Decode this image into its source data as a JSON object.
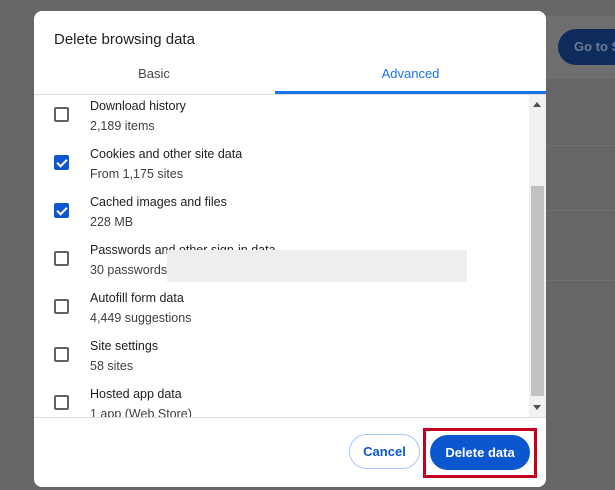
{
  "background": {
    "button_label": "Go to S"
  },
  "dialog": {
    "title": "Delete browsing data",
    "tabs": [
      {
        "label": "Basic",
        "selected": false
      },
      {
        "label": "Advanced",
        "selected": true
      }
    ],
    "items": [
      {
        "title": "Download history",
        "subtitle": "2,189 items",
        "checked": false
      },
      {
        "title": "Cookies and other site data",
        "subtitle": "From 1,175 sites",
        "checked": true
      },
      {
        "title": "Cached images and files",
        "subtitle": "228 MB",
        "checked": true
      },
      {
        "title": "Passwords and other sign-in data",
        "subtitle": "30 passwords",
        "checked": false
      },
      {
        "title": "Autofill form data",
        "subtitle": "4,449 suggestions",
        "checked": false
      },
      {
        "title": "Site settings",
        "subtitle": "58 sites",
        "checked": false
      },
      {
        "title": "Hosted app data",
        "subtitle": "1 app (Web Store)",
        "checked": false
      }
    ],
    "cancel_label": "Cancel",
    "delete_label": "Delete data",
    "accent": "#0b57d0",
    "highlight_color": "#c8001e"
  }
}
